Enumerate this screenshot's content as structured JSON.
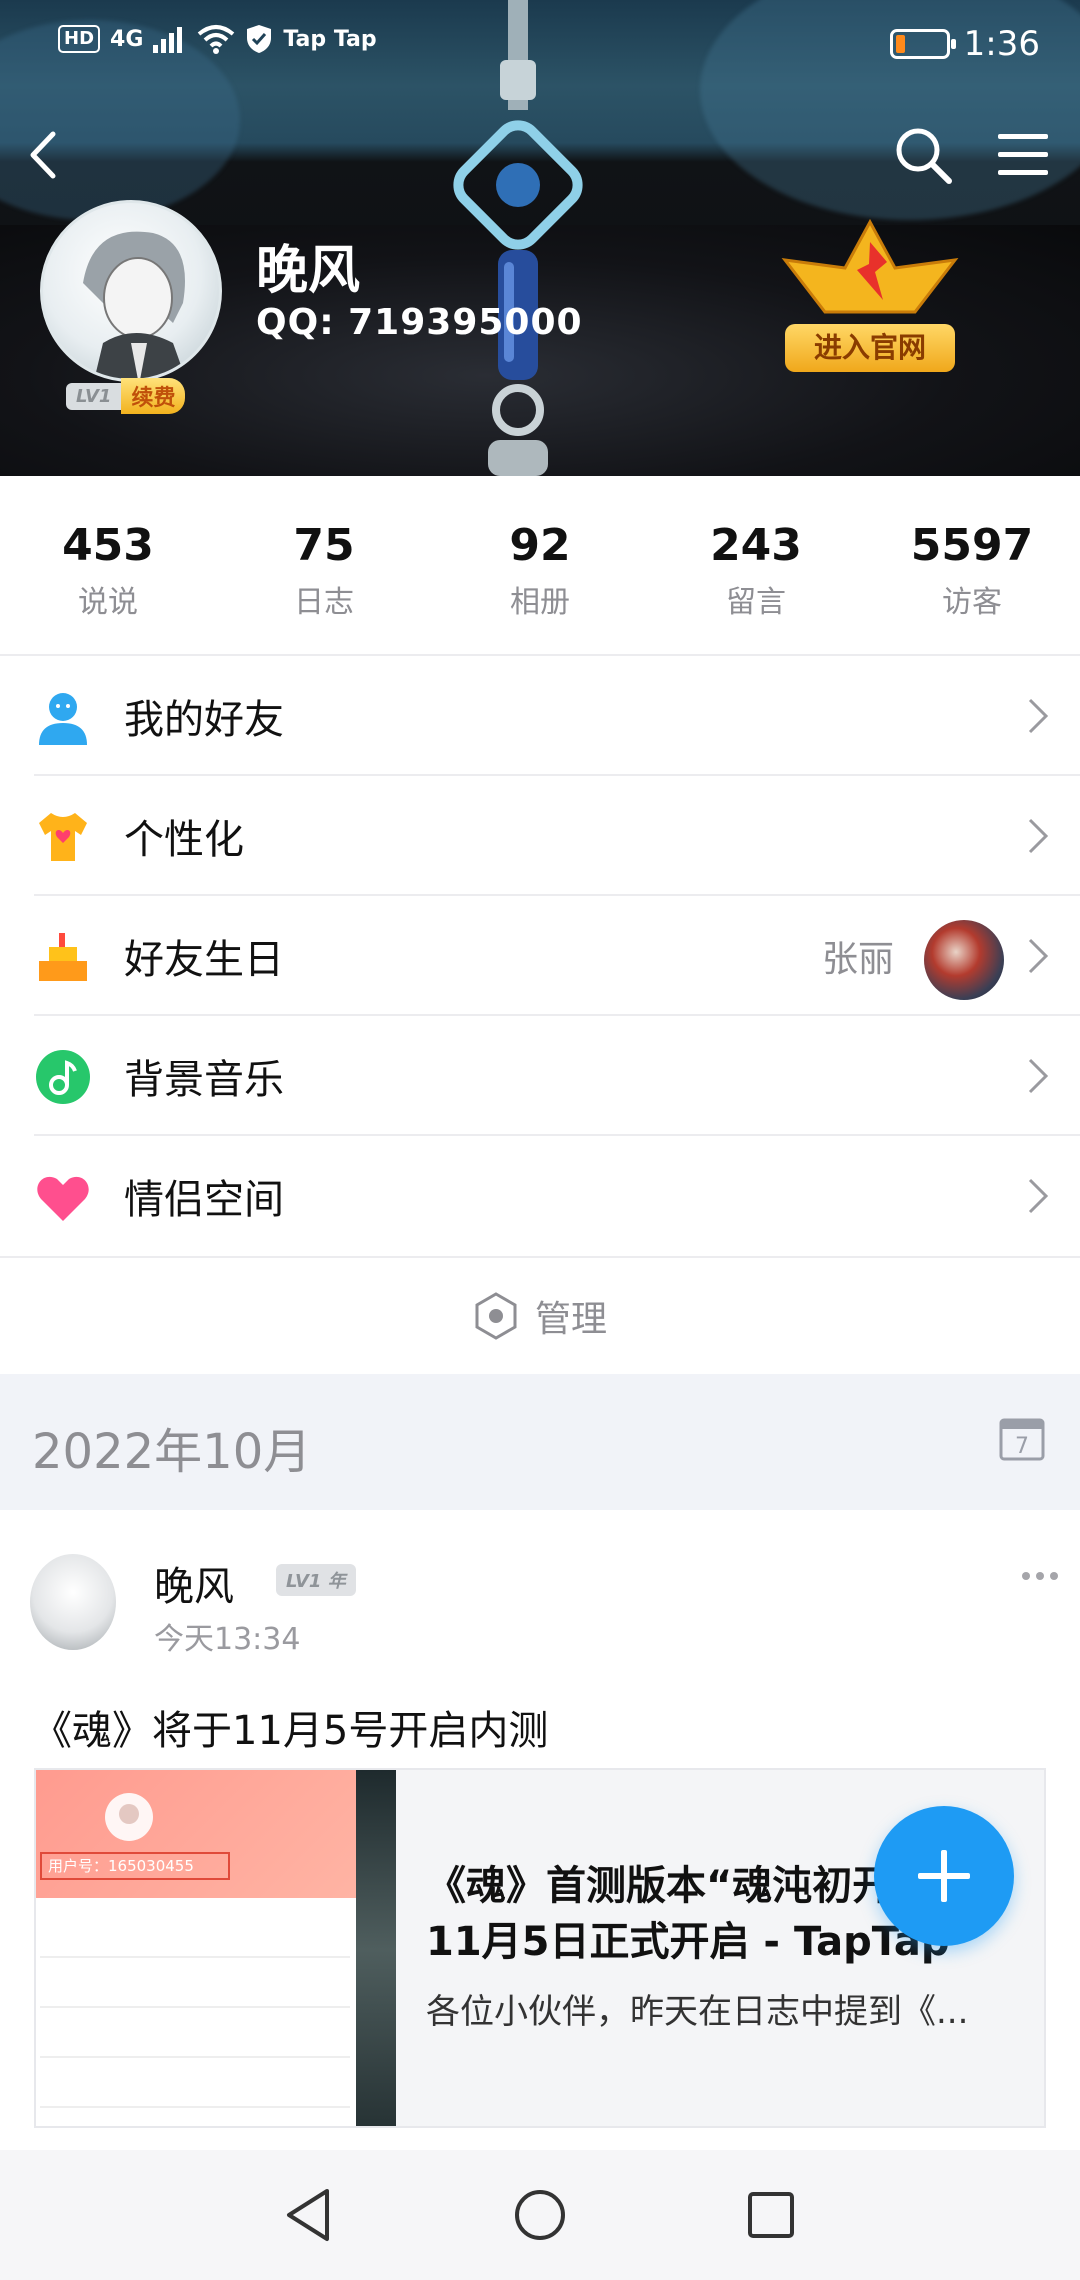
{
  "status_bar": {
    "hd": "HD",
    "network": "4G",
    "carrier_apps": "Tap  Tap",
    "time": "1:36",
    "battery_level": 0.18,
    "colors": {
      "battery_low": "#ff8a1c"
    }
  },
  "nav": {
    "back_icon": "back-chevron-icon",
    "search_icon": "search-icon",
    "menu_icon": "hamburger-menu-icon"
  },
  "profile": {
    "name": "晚风",
    "qq": "QQ:  719395000",
    "level": "LV1",
    "renew_label": "续费",
    "official_label": "进入官网"
  },
  "stats": [
    {
      "num": "453",
      "label": "说说"
    },
    {
      "num": "75",
      "label": "日志"
    },
    {
      "num": "92",
      "label": "相册"
    },
    {
      "num": "243",
      "label": "留言"
    },
    {
      "num": "5597",
      "label": "访客"
    }
  ],
  "menu": {
    "friends": {
      "label": "我的好友",
      "icon": "person-icon"
    },
    "personalize": {
      "label": "个性化",
      "icon": "tshirt-icon"
    },
    "birthday": {
      "label": "好友生日",
      "value": "张丽",
      "icon": "cake-icon"
    },
    "music": {
      "label": "背景音乐",
      "icon": "music-note-icon"
    },
    "couple": {
      "label": "情侣空间",
      "icon": "heart-icon"
    }
  },
  "manage": {
    "label": "管理",
    "icon": "hexagon-icon"
  },
  "date_section": {
    "date": "2022年10月",
    "calendar_day": "7"
  },
  "post": {
    "author": "晚风",
    "level": "LV1",
    "level_suffix": "年",
    "time": "今天13:34",
    "text": "《魂》将于11月5号开启内测",
    "card": {
      "uid_text": "用户号：165030455",
      "title": "《魂》首测版本“魂沌初开”于11月5日正式开启 - TapTap",
      "desc": "各位小伙伴，昨天在日志中提到《..."
    }
  },
  "colors": {
    "accent": "#1e9bf4",
    "muted_text": "#8e8e93",
    "section_bg": "#f1f3f8"
  }
}
